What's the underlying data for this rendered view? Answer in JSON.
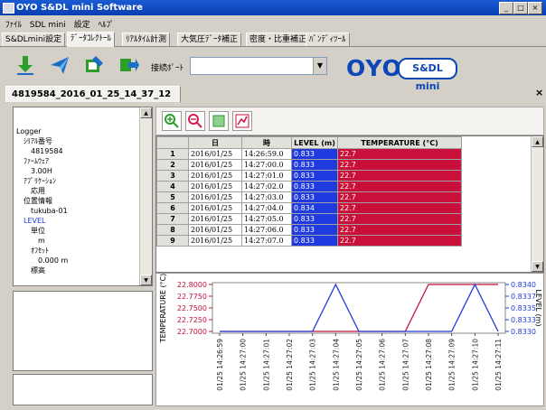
{
  "window": {
    "title": "OYO S&DL mini Software",
    "buttons": [
      "_",
      "□",
      "×"
    ]
  },
  "menu": [
    "ﾌｧｲﾙ",
    "SDL mini",
    "設定",
    "ﾍﾙﾌﾟ"
  ],
  "tabs": [
    {
      "label": "S&DLmini設定",
      "active": false
    },
    {
      "label": "ﾃﾞｰﾀｺﾚｸﾄｰﾙ",
      "active": true
    },
    {
      "label": "ﾘｱﾙﾀｲﾑ計測",
      "active": false
    },
    {
      "label": "大気圧ﾃﾞｰﾀ補正",
      "active": false
    },
    {
      "label": "密度・比重補正",
      "active": false
    },
    {
      "label": "ﾊﾞﾝﾃﾞｨﾂｰﾙ",
      "active": false
    }
  ],
  "toolbar": {
    "port_label": "接続ﾎﾟｰﾄ",
    "port_value": "",
    "brand_logo": "OYO",
    "product_badge": "S&DL mini"
  },
  "file_tab": "4819584_2016_01_25_14_37_12",
  "tree": [
    {
      "text": "Logger",
      "level": 0,
      "color": "#000"
    },
    {
      "text": "ｼﾘｱﾙ番号",
      "level": 1,
      "color": "#000"
    },
    {
      "text": "4819584",
      "level": 2,
      "color": "#000"
    },
    {
      "text": "ﾌｧｰﾑｳｪｱ",
      "level": 1,
      "color": "#000"
    },
    {
      "text": "3.00H",
      "level": 2,
      "color": "#000"
    },
    {
      "text": "ｱﾌﾟﾘｹｰｼｮﾝ",
      "level": 1,
      "color": "#000"
    },
    {
      "text": "応用",
      "level": 2,
      "color": "#000"
    },
    {
      "text": "位置情報",
      "level": 1,
      "color": "#000"
    },
    {
      "text": "tukuba-01",
      "level": 2,
      "color": "#000"
    },
    {
      "text": "LEVEL",
      "level": 1,
      "color": "#1f3be0"
    },
    {
      "text": "単位",
      "level": 2,
      "color": "#000"
    },
    {
      "text": "m",
      "level": 3,
      "color": "#000"
    },
    {
      "text": "ｵﾌｾｯﾄ",
      "level": 2,
      "color": "#000"
    },
    {
      "text": "0.000 m",
      "level": 3,
      "color": "#000"
    },
    {
      "text": "標高",
      "level": 2,
      "color": "#000"
    }
  ],
  "table": {
    "headers": [
      "",
      "日",
      "時",
      "LEVEL (m)",
      "TEMPERATURE (°C)"
    ],
    "rows": [
      {
        "n": "1",
        "date": "2016/01/25",
        "time": "14:26:59.0",
        "level": "0.833",
        "temp": "22.7"
      },
      {
        "n": "2",
        "date": "2016/01/25",
        "time": "14:27:00.0",
        "level": "0.833",
        "temp": "22.7"
      },
      {
        "n": "3",
        "date": "2016/01/25",
        "time": "14:27:01.0",
        "level": "0.833",
        "temp": "22.7"
      },
      {
        "n": "4",
        "date": "2016/01/25",
        "time": "14:27:02.0",
        "level": "0.833",
        "temp": "22.7"
      },
      {
        "n": "5",
        "date": "2016/01/25",
        "time": "14:27:03.0",
        "level": "0.833",
        "temp": "22.7"
      },
      {
        "n": "6",
        "date": "2016/01/25",
        "time": "14:27:04.0",
        "level": "0.834",
        "temp": "22.7"
      },
      {
        "n": "7",
        "date": "2016/01/25",
        "time": "14:27:05.0",
        "level": "0.833",
        "temp": "22.7"
      },
      {
        "n": "8",
        "date": "2016/01/25",
        "time": "14:27:06.0",
        "level": "0.833",
        "temp": "22.7"
      },
      {
        "n": "9",
        "date": "2016/01/25",
        "time": "14:27:07.0",
        "level": "0.833",
        "temp": "22.7"
      }
    ]
  },
  "colors": {
    "level": "#1f3be0",
    "temperature": "#c8103a",
    "title_blue": "#0a3fb0",
    "brand": "#0d47b5"
  },
  "chart_data": {
    "type": "line",
    "x": [
      "01/25 14:26:59",
      "01/25 14:27:00",
      "01/25 14:27:01",
      "01/25 14:27:02",
      "01/25 14:27:03",
      "01/25 14:27:04",
      "01/25 14:27:05",
      "01/25 14:27:06",
      "01/25 14:27:07",
      "01/25 14:27:08",
      "01/25 14:27:09",
      "01/25 14:27:10",
      "01/25 14:27:11"
    ],
    "ylabel_left": "TEMPERATURE (°C)",
    "ylabel_right": "LEVEL (m)",
    "ylim_left": [
      22.7,
      22.8
    ],
    "ylim_right": [
      0.833,
      0.834
    ],
    "yticks_left": [
      "22.8000",
      "22.7750",
      "22.7500",
      "22.7250",
      "22.7000"
    ],
    "yticks_right": [
      "0.8340",
      "0.8337",
      "0.8335",
      "0.8333",
      "0.8330"
    ],
    "series": [
      {
        "axis": "left",
        "color": "#c8103a",
        "values": [
          22.7,
          22.7,
          22.7,
          22.7,
          22.7,
          22.7,
          22.7,
          22.7,
          22.7,
          22.8,
          22.8,
          22.8,
          22.8
        ]
      },
      {
        "axis": "right",
        "color": "#1f3be0",
        "values": [
          0.833,
          0.833,
          0.833,
          0.833,
          0.833,
          0.834,
          0.833,
          0.833,
          0.833,
          0.833,
          0.833,
          0.834,
          0.833
        ]
      }
    ],
    "grid": false
  }
}
